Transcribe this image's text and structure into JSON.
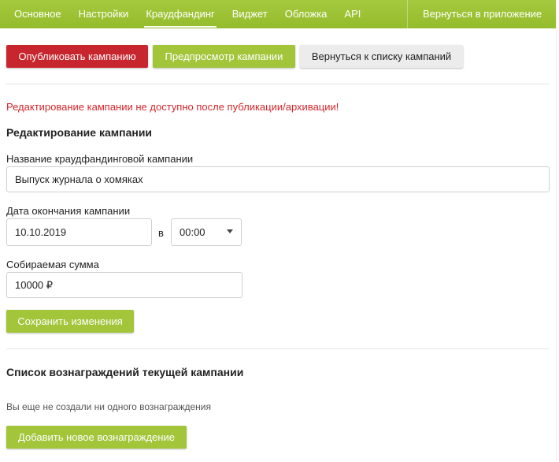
{
  "nav": {
    "tabs": [
      {
        "label": "Основное"
      },
      {
        "label": "Настройки"
      },
      {
        "label": "Краудфандинг"
      },
      {
        "label": "Виджет"
      },
      {
        "label": "Обложка"
      },
      {
        "label": "API"
      }
    ],
    "active_tab": "Краудфандинг",
    "back_to_app": "Вернуться в приложение"
  },
  "toolbar": {
    "publish": "Опубликовать кампанию",
    "preview": "Предпросмотр кампании",
    "back_to_list": "Вернуться к списку кампаний"
  },
  "notice": "Редактирование кампании не доступно после публикации/архивации!",
  "edit": {
    "heading": "Редактирование кампании",
    "name_label": "Название краудфандинговой кампании",
    "name_value": "Выпуск журнала о хомяках",
    "end_date_label": "Дата окончания кампании",
    "end_date_value": "10.10.2019",
    "at_label": "в",
    "time_value": "00:00",
    "amount_label": "Собираемая сумма",
    "amount_value": "10000 ₽",
    "save": "Сохранить изменения"
  },
  "rewards": {
    "heading": "Список вознаграждений текущей кампании",
    "empty": "Вы еще не создали ни одного вознаграждения",
    "add": "Добавить новое вознаграждение"
  },
  "colors": {
    "nav_green": "#9cc235",
    "danger": "#c8262e",
    "accent": "#a2c53a",
    "error_text": "#d3262b"
  }
}
